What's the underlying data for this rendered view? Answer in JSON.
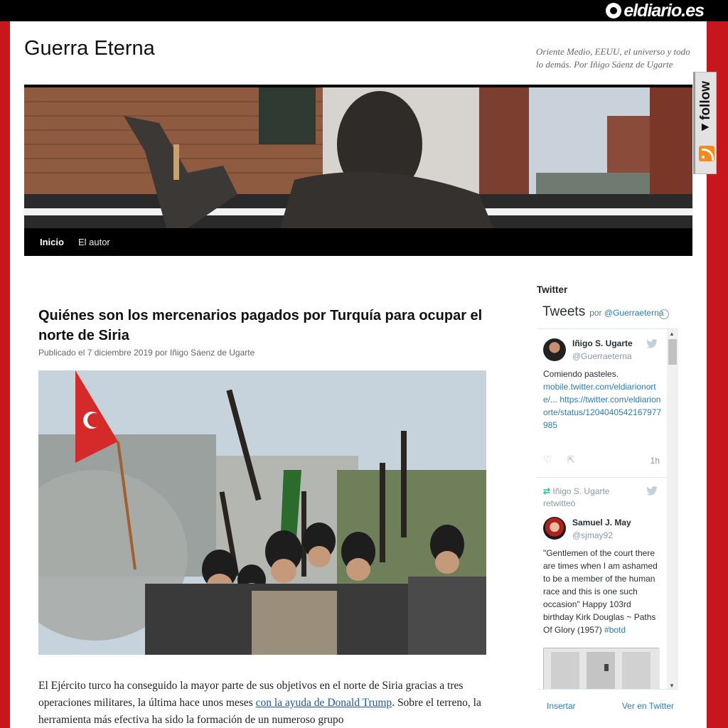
{
  "brand": {
    "name": "eldiario.es"
  },
  "site": {
    "title": "Guerra Eterna",
    "description": "Oriente Medio, EEUU, el universo y todo lo demás. Por Iñigo Sáenz de Ugarte"
  },
  "nav": {
    "items": [
      {
        "label": "Inicio",
        "active": true
      },
      {
        "label": "El autor",
        "active": false
      }
    ]
  },
  "post": {
    "title": "Quiénes son los mercenarios pagados por Turquía para ocupar el norte de Siria",
    "meta_prefix": "Publicado el",
    "date": "7 diciembre 2019",
    "meta_by": "por",
    "author": "Iñigo Sáenz de Ugarte",
    "text_1": "El Ejército turco ha conseguido la mayor parte de sus objetivos en el norte de Siria gracias a tres operaciones militares, la última hace unos meses ",
    "link": "con la ayuda de Donald Trump",
    "text_2": ". Sobre el terreno, la herramienta más efectiva ha sido la formación de un numeroso grupo"
  },
  "sidebar": {
    "twitter_title": "Twitter",
    "widget": {
      "heading": "Tweets",
      "by": "por",
      "handle": "@Guerraeterna",
      "tweets": [
        {
          "name": "Iñigo S. Ugarte",
          "handle": "@Guerraeterna",
          "text": "Comiendo pasteles.",
          "link_1": "mobile.twitter.com/eldiarionorte/...",
          "link_2": "https://twitter.com/eldiarionorte/status/1204040542167977985",
          "time": "1h"
        },
        {
          "retweeted_by": "Iñigo S. Ugarte",
          "retweet_label": "retwitteó",
          "name": "Samuel J. May",
          "handle": "@sjmay92",
          "text": "\"Gentlemen of the court there are times when I am ashamed to be a member of the human race and this is one such occasion\" Happy 103rd birthday Kirk Douglas ~ Paths Of Glory (1957) ",
          "hashtag": "#botd"
        }
      ],
      "footer_left": "Insertar",
      "footer_right": "Ver en Twitter"
    }
  },
  "follow": {
    "label": "follow"
  },
  "colors": {
    "frame": "#c8161d",
    "link": "#1b57b1",
    "twitter_blue": "#2b7bb9"
  },
  "icons": [
    "twitter-bird-icon",
    "heart-icon",
    "share-icon",
    "retweet-icon",
    "rss-icon",
    "info-icon"
  ]
}
